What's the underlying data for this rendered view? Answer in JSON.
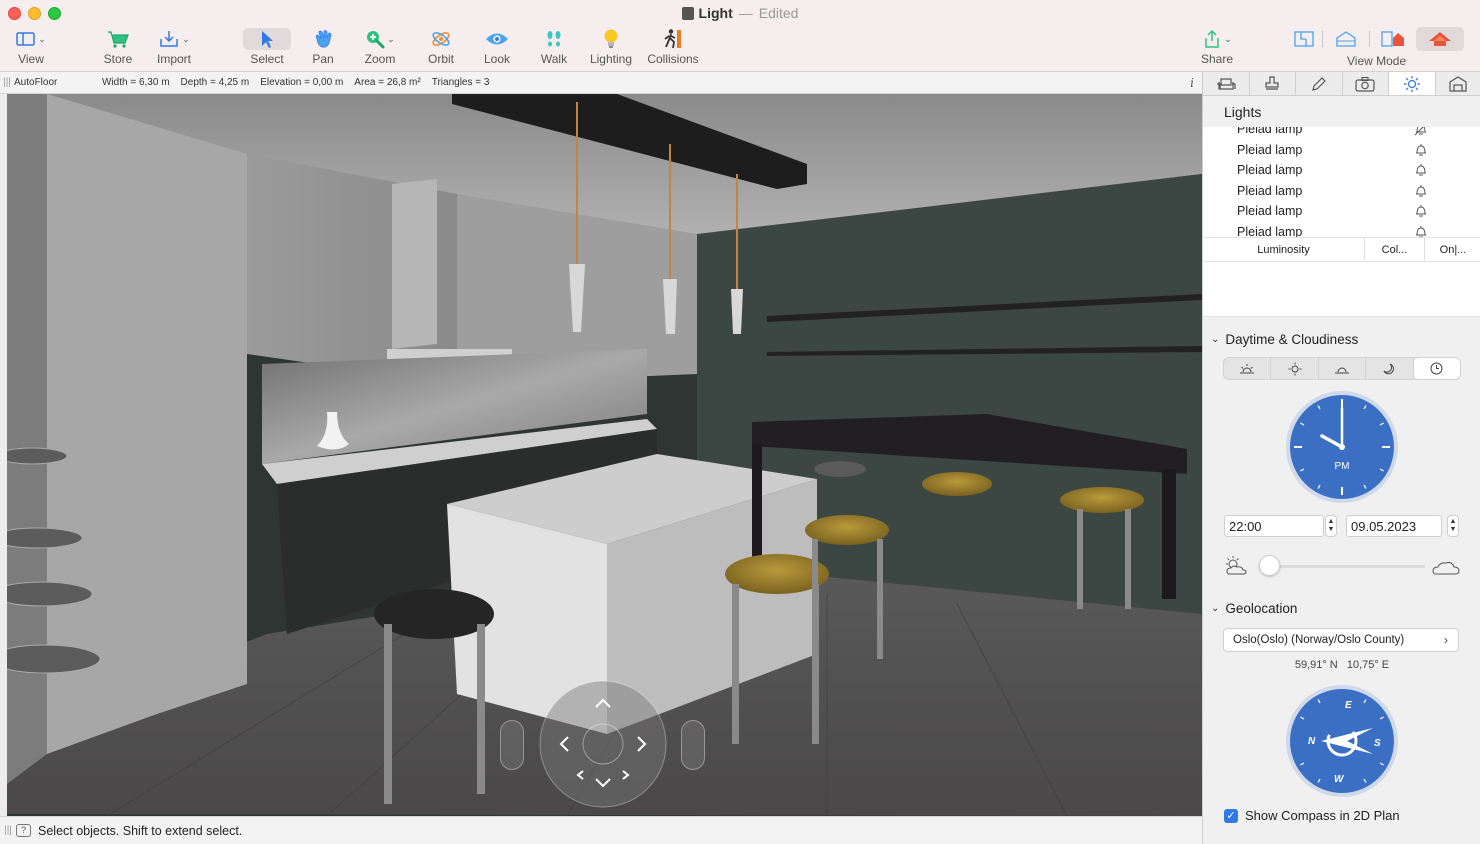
{
  "window": {
    "title": "Light",
    "separator": "—",
    "status": "Edited"
  },
  "toolbar": {
    "view": "View",
    "store": "Store",
    "import": "Import",
    "select": "Select",
    "pan": "Pan",
    "zoom": "Zoom",
    "orbit": "Orbit",
    "look": "Look",
    "walk": "Walk",
    "lighting": "Lighting",
    "collisions": "Collisions",
    "share": "Share",
    "view_mode": "View Mode"
  },
  "infobar": {
    "name": "AutoFloor",
    "width": "Width = 6,30 m",
    "depth": "Depth = 4,25 m",
    "elevation": "Elevation = 0,00 m",
    "area": "Area = 26,8 m²",
    "triangles": "Triangles = 3",
    "info": "i"
  },
  "status": {
    "text": "Select objects. Shift to extend select."
  },
  "panel": {
    "lights_title": "Lights",
    "lights": [
      {
        "name": "Pleiad lamp"
      },
      {
        "name": "Pleiad lamp"
      },
      {
        "name": "Pleiad lamp"
      },
      {
        "name": "Pleiad lamp"
      },
      {
        "name": "Pleiad lamp"
      },
      {
        "name": "Pleiad lamp"
      }
    ],
    "columns": {
      "luminosity": "Luminosity",
      "color": "Col...",
      "on": "On|..."
    },
    "daytime_title": "Daytime & Cloudiness",
    "time": "22:00",
    "date": "09.05.2023",
    "clock_label": "PM",
    "cloudiness": 0.0,
    "geo_title": "Geolocation",
    "location": "Oslo(Oslo) (Norway/Oslo County)",
    "latitude": "59,91° N",
    "longitude": "10,75° E",
    "compass_letters": {
      "n": "N",
      "e": "E",
      "s": "S",
      "w": "W"
    },
    "show_compass_label": "Show Compass in 2D Plan",
    "show_compass_checked": true
  },
  "colors": {
    "accent": "#2f7ae5",
    "clock_blue": "#3a6fc4",
    "titlebar": "#f6eeee"
  }
}
